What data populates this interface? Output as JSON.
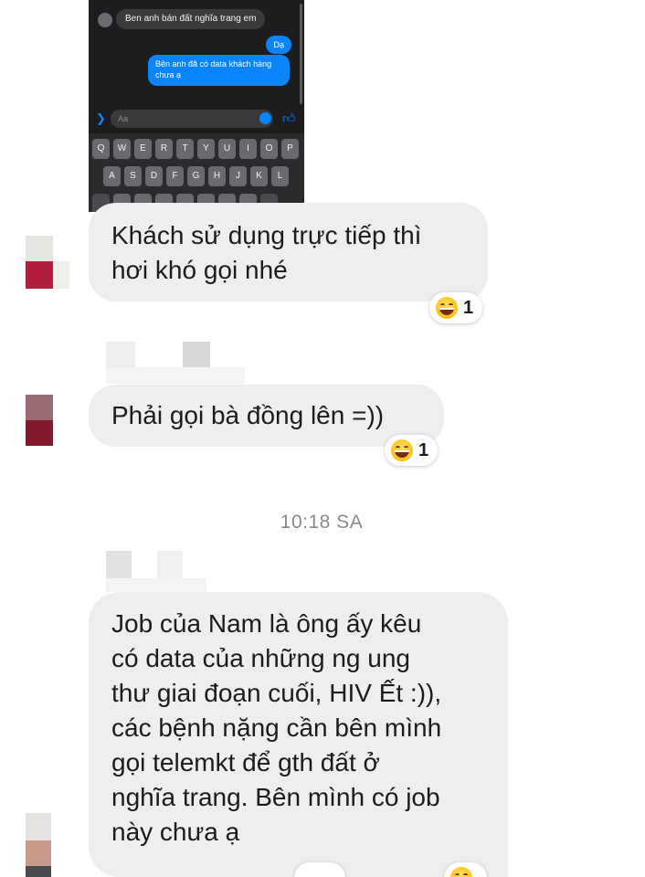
{
  "embedded_screenshot": {
    "incoming_message": "Ben anh bán đất nghĩa trang em",
    "outgoing_messages": [
      "Dạ",
      "Bên anh đã có data khách hàng chưa ạ"
    ],
    "composer_placeholder": "Aa",
    "keyboard_row1": [
      "Q",
      "W",
      "E",
      "R",
      "T",
      "Y",
      "U",
      "I",
      "O",
      "P"
    ],
    "keyboard_row2": [
      "A",
      "S",
      "D",
      "F",
      "G",
      "H",
      "J",
      "K",
      "L"
    ]
  },
  "messages": [
    {
      "text": "Khách sử dụng trực tiếp thì\nhơi khó gọi nhé",
      "reaction": {
        "emoji": "grinning-squint-emoji",
        "count": "1"
      }
    },
    {
      "text": "Phải gọi bà đồng lên =))",
      "reaction": {
        "emoji": "grinning-squint-emoji",
        "count": "1"
      }
    },
    {
      "text": "Job của Nam là ông ấy kêu\ncó data của những ng ung\nthư giai đoạn cuối, HIV Ết :)),\ncác bệnh nặng cần bên mình\ngọi telemkt để gth đất ở\nnghĩa trang. Bên mình có job\nnày chưa ạ",
      "reaction": {
        "emoji": "grinning-squint-emoji",
        "count": ""
      }
    }
  ],
  "timestamp": "10:18 SA",
  "colors": {
    "bubble": "#efedee",
    "outgoing": "#0a84ff",
    "timestamp": "#8a8a8e"
  }
}
